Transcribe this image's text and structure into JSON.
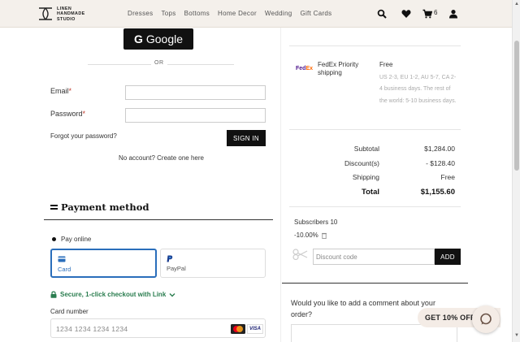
{
  "header": {
    "logo_lines": [
      "LINEN",
      "HANDMADE",
      "STUDIO"
    ],
    "nav": [
      "Dresses",
      "Tops",
      "Bottoms",
      "Home Decor",
      "Wedding",
      "Gift Cards"
    ],
    "cart_count": "6"
  },
  "login": {
    "google_label": "Google",
    "google_g": "G",
    "or_text": "OR",
    "email_label": "Email",
    "password_label": "Password",
    "required_mark": "*",
    "forgot": "Forgot your password?",
    "signin_label": "SIGN IN",
    "no_account": "No account? Create one here"
  },
  "payment": {
    "title": "Payment method",
    "pay_online": "Pay online",
    "tabs": [
      {
        "label": "Card",
        "active": true
      },
      {
        "label": "PayPal",
        "active": false
      }
    ],
    "secure_text": "Secure, 1-click checkout with Link",
    "card_number_label": "Card number",
    "card_number_placeholder": "1234 1234 1234 1234",
    "visa_label": "VISA"
  },
  "shipping": {
    "carrier_logo_fe": "Fed",
    "carrier_logo_ex": "Ex",
    "name": "FedEx Priority shipping",
    "price": "Free",
    "description": "US 2-3, EU 1-2, AU 5-7, CA 2-4 business days. The rest of the world: 5-10 business days."
  },
  "totals": [
    {
      "label": "Subtotal",
      "value": "$1,284.00"
    },
    {
      "label": "Discount(s)",
      "value": "- $128.40"
    },
    {
      "label": "Shipping",
      "value": "Free"
    },
    {
      "label": "Total",
      "value": "$1,155.60"
    }
  ],
  "discount": {
    "subscribers": "Subscribers 10",
    "percent": "-10.00%",
    "placeholder": "Discount code",
    "add_label": "ADD"
  },
  "comment": {
    "question": "Would you like to add a comment about your order?"
  },
  "promo": {
    "label": "GET 10% OFF"
  },
  "colors": {
    "header_bg": "#f4f0eb",
    "accent_blue": "#2a6ebb",
    "secure_green": "#2a7d4f",
    "button_black": "#111111"
  }
}
